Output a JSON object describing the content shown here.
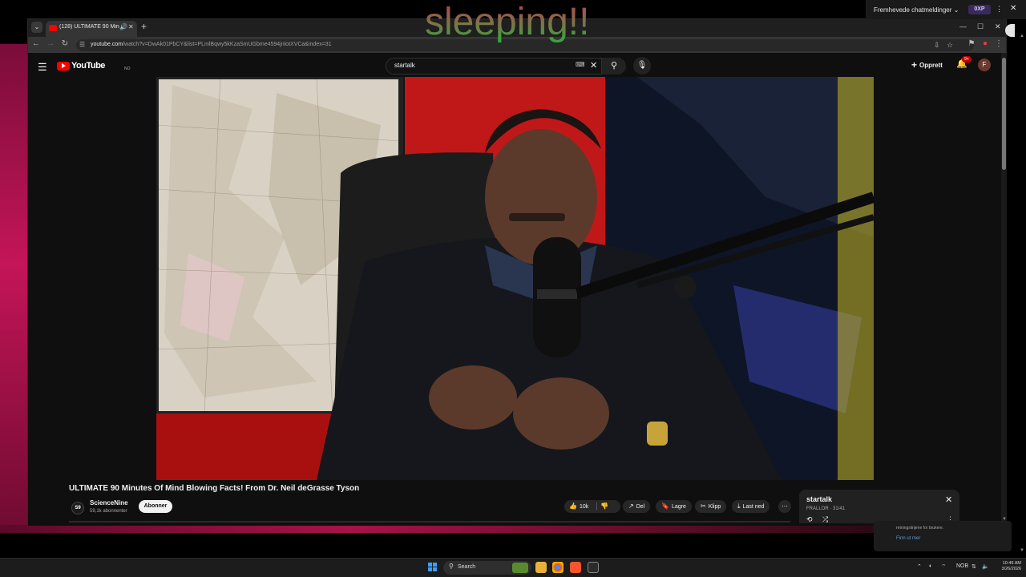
{
  "overlay": {
    "text": "sleeping!!"
  },
  "chat_widget": {
    "label": "Fremhevede chatmeldinger",
    "xp_badge": "0XP",
    "footer_rules": "retningslinjene for brukere.",
    "footer_find": "Finn ut mer"
  },
  "browser": {
    "tab": {
      "title": "(128) ULTIMATE 90 Minutes Of Mind Blowing Facts! From Dr. Neil deGrasse Tyson"
    },
    "url": {
      "domain": "youtube.com",
      "path": "/watch?v=DwAk01PbCY&list=PLmlBqwy5kKzaSmUGbme4594jnlotXVCa&index=31"
    }
  },
  "youtube": {
    "logo_text": "YouTube",
    "region": "NO",
    "search": {
      "value": "startalk"
    },
    "create_label": "Opprett",
    "notification_count": "9+",
    "avatar_letter": "F",
    "video": {
      "title": "ULTIMATE 90 Minutes Of Mind Blowing Facts! From Dr. Neil deGrasse Tyson",
      "channel": "ScienceNine",
      "channel_initials": "S9",
      "subscribers": "59,1k abonnenter",
      "subscribe_label": "Abonner",
      "likes": "10k",
      "share_label": "Del",
      "save_label": "Lagre",
      "clip_label": "Klipp",
      "download_label": "Last ned"
    },
    "playlist": {
      "title": "startalk",
      "meta": "FRALLOR · 31/41"
    }
  },
  "taskbar": {
    "search_label": "Search",
    "lang": "NOB",
    "time": "10:46 AM",
    "date": "3/26/2026"
  },
  "colors": {
    "yt_red": "#ff0000",
    "page_bg": "#0f0f0f",
    "overlay_top": "#b0404a",
    "overlay_bottom": "#29b039"
  }
}
